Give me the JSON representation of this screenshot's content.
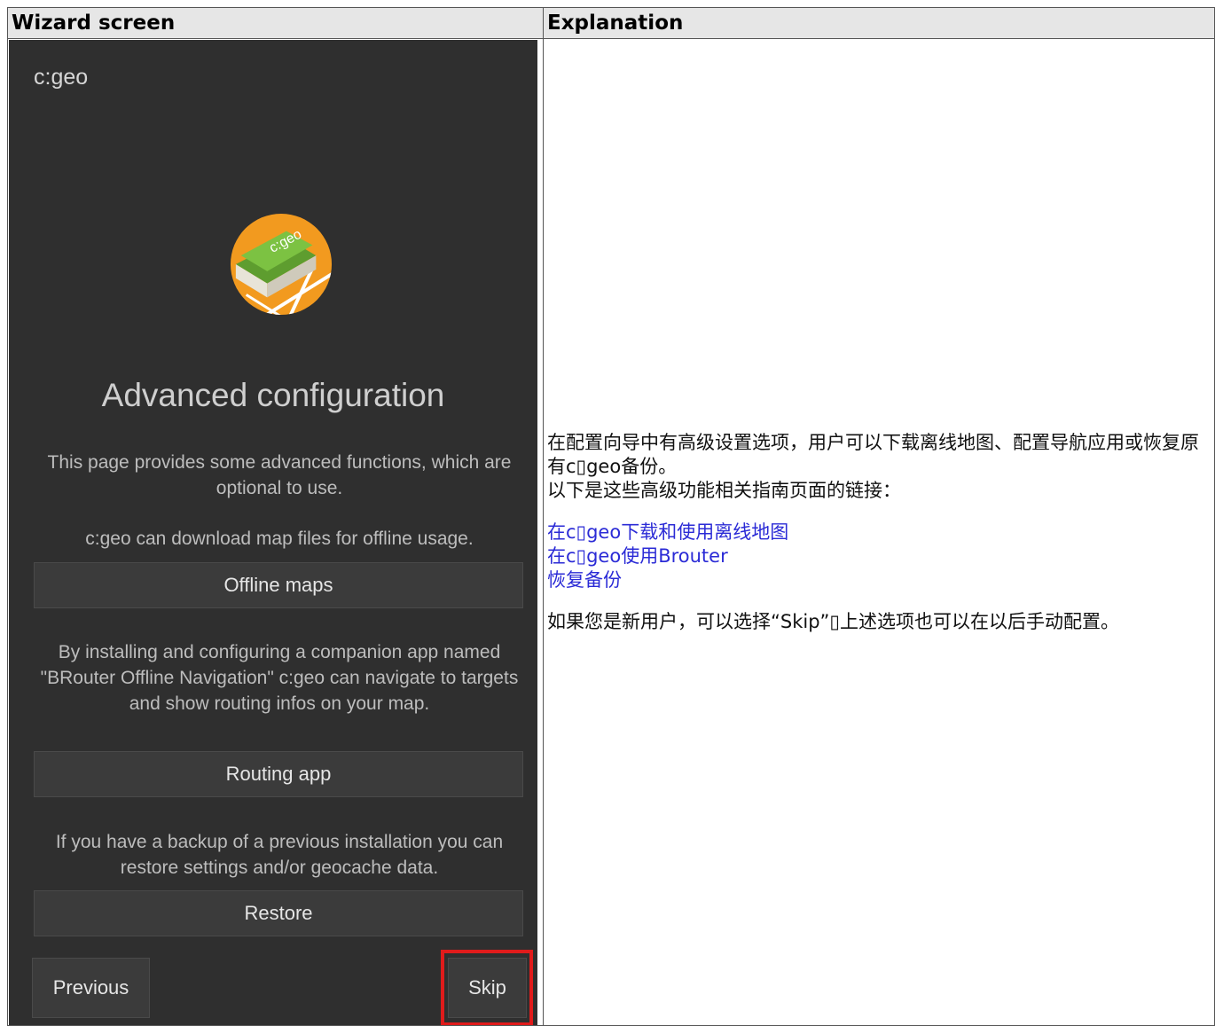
{
  "table": {
    "headers": [
      "Wizard screen",
      "Explanation"
    ]
  },
  "wizard": {
    "app_title": "c:geo",
    "logo_text": "c:geo",
    "title": "Advanced configuration",
    "intro": "This page provides some advanced functions, which are optional to use.",
    "offline_text": "c:geo can download map files for offline usage.",
    "offline_button": "Offline maps",
    "routing_text": "By installing and configuring a companion app named \"BRouter Offline Navigation\" c:geo can navigate to targets and show routing infos on your map.",
    "routing_button": "Routing app",
    "restore_text": "If you have a backup of a previous installation you can restore settings and/or geocache data.",
    "restore_button": "Restore",
    "previous_button": "Previous",
    "skip_button": "Skip",
    "colors": {
      "background": "#2f2f2f",
      "button": "#3b3b3b",
      "highlight": "#e01b1b",
      "logo_orange": "#f29a1f",
      "logo_green": "#7cc242"
    }
  },
  "explanation": {
    "paragraph1": "在配置向导中有高级设置选项，用户可以下载离线地图、配置导航应用或恢复原有c▯geo备份。",
    "paragraph2": "以下是这些高级功能相关指南页面的链接：",
    "links": [
      "在c▯geo下载和使用离线地图",
      "在c▯geo使用Brouter",
      "恢复备份"
    ],
    "paragraph3": "如果您是新用户，可以选择“Skip”▯上述选项也可以在以后手动配置。",
    "link_color": "#2b2bd6"
  }
}
